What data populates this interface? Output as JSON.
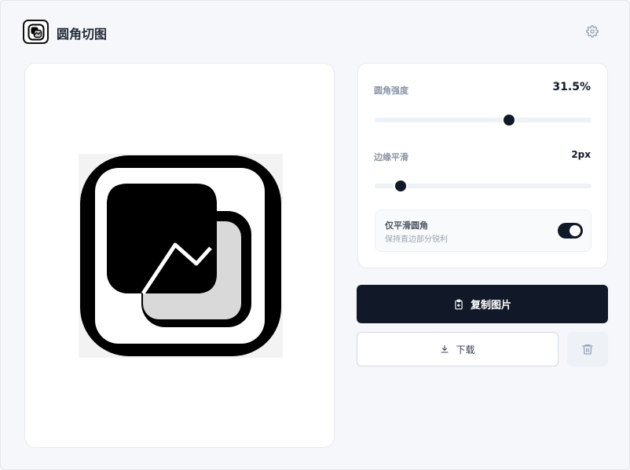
{
  "app": {
    "title": "圆角切图",
    "logo_icon": "rounded-image-icon",
    "settings_icon": "gear-icon"
  },
  "settings": {
    "radius": {
      "label": "圆角强度",
      "value_text": "31.5%",
      "fraction": 0.62
    },
    "smoothing": {
      "label": "边缘平滑",
      "value_text": "2px",
      "fraction": 0.12
    },
    "corner_only": {
      "title": "仅平滑圆角",
      "subtitle": "保持直边部分锐利",
      "enabled": true
    }
  },
  "actions": {
    "copy": {
      "label": "复制图片",
      "icon": "clipboard-icon"
    },
    "download": {
      "label": "下载",
      "icon": "download-icon"
    },
    "delete": {
      "icon": "trash-icon"
    }
  },
  "colors": {
    "primary": "#111827",
    "background": "#f6f7fb"
  }
}
